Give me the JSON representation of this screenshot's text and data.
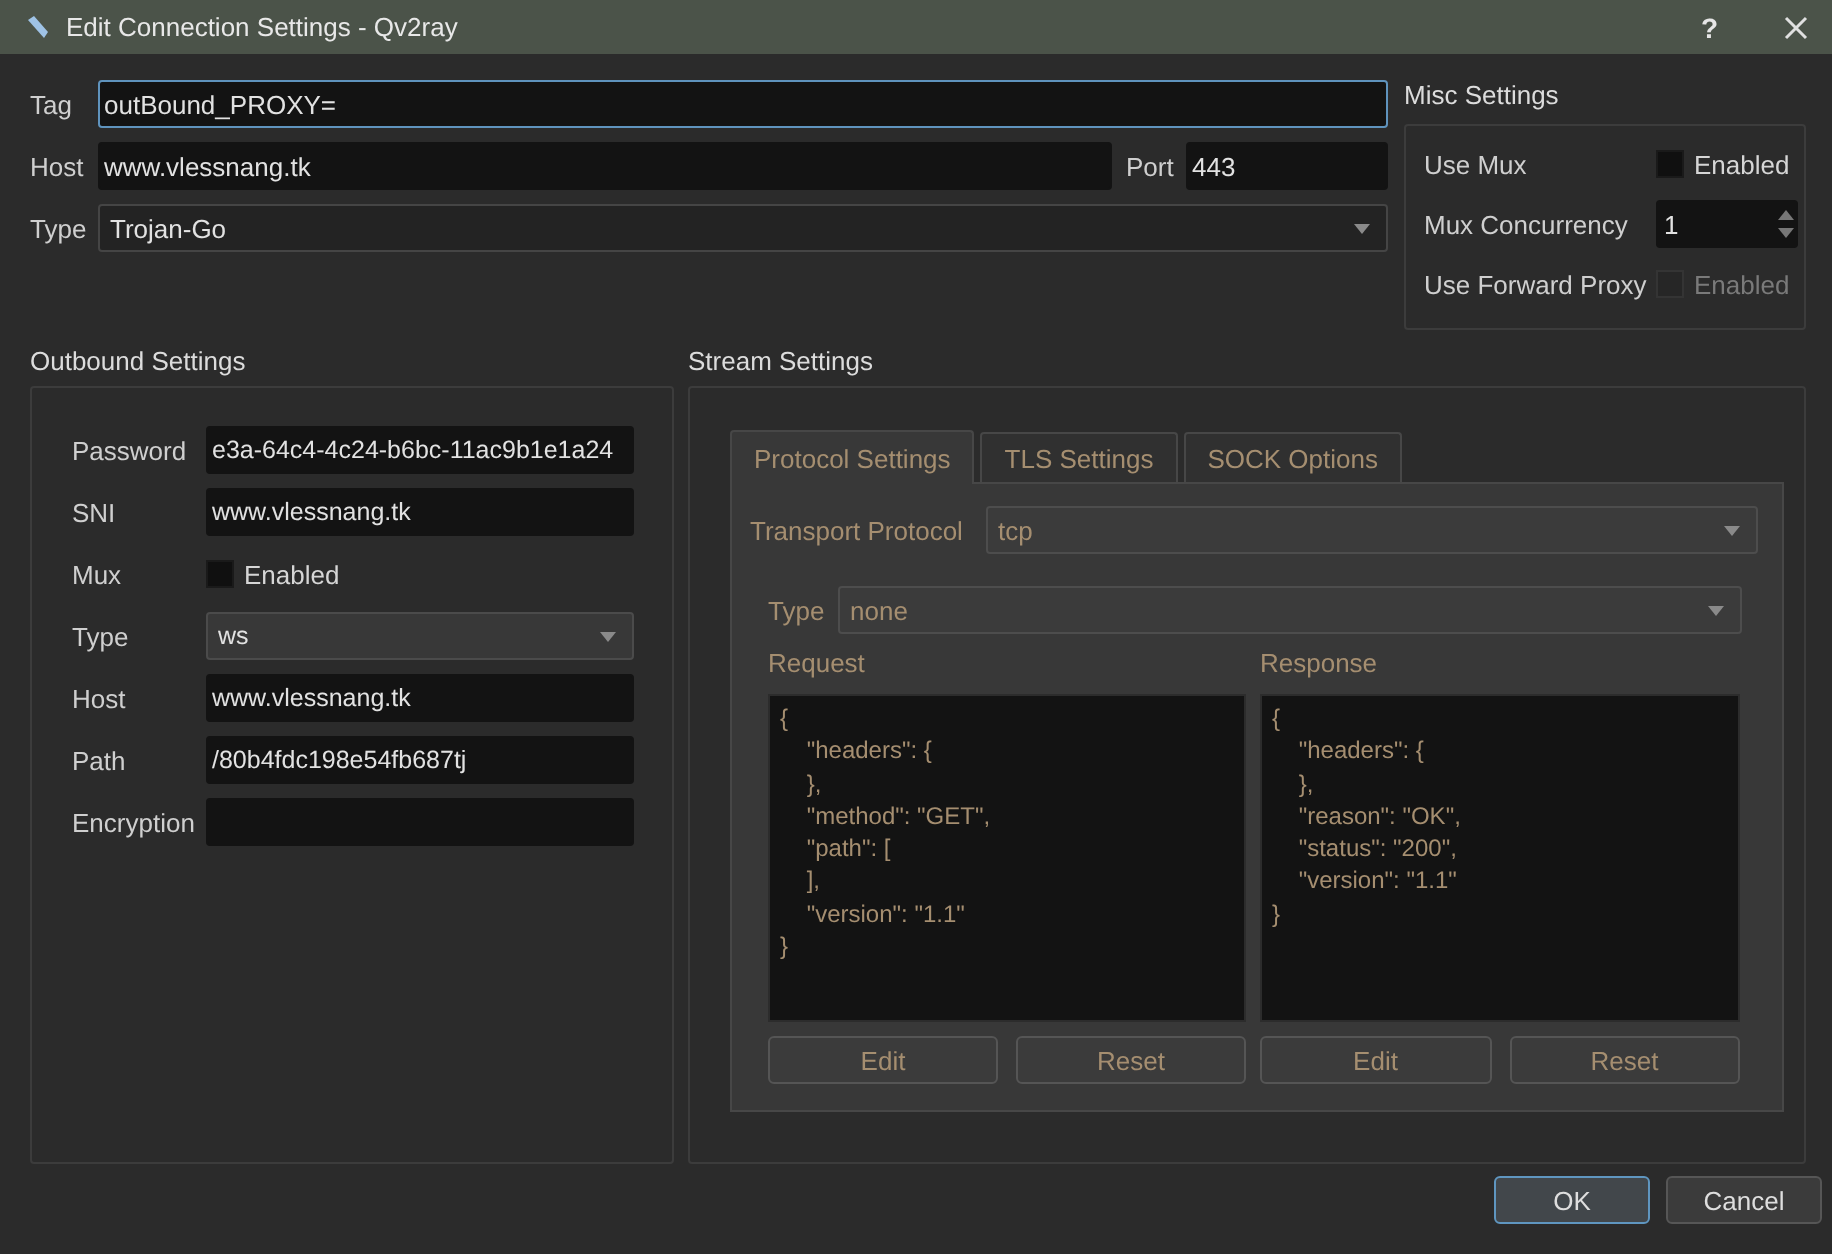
{
  "window": {
    "title": "Edit Connection Settings - Qv2ray",
    "help": "?"
  },
  "general": {
    "tag": {
      "label": "Tag",
      "value": "outBound_PROXY=",
      "focused": true
    },
    "host": {
      "label": "Host",
      "value": "www.vlessnang.tk",
      "focused": false
    },
    "port": {
      "label": "Port",
      "value": "443",
      "focused": false
    },
    "type": {
      "label": "Type",
      "value": "Trojan-Go"
    }
  },
  "misc_settings": {
    "title": "Misc Settings",
    "rows": [
      {
        "kind": "checkbox",
        "label": "Use Mux",
        "text": "Enabled",
        "checked": false,
        "disabled": false
      },
      {
        "kind": "spinbox",
        "label": "Mux Concurrency",
        "value": "1"
      },
      {
        "kind": "checkbox",
        "label": "Use Forward Proxy",
        "text": "Enabled",
        "checked": false,
        "disabled": true
      }
    ]
  },
  "outbound_settings": {
    "title": "Outbound Settings",
    "rows": [
      {
        "kind": "field",
        "label": "Password",
        "value": "e3a-64c4-4c24-b6bc-11ac9b1e1a24"
      },
      {
        "kind": "field",
        "label": "SNI",
        "value": "www.vlessnang.tk"
      },
      {
        "kind": "checkbox",
        "label": "Mux",
        "text": "Enabled",
        "checked": false
      },
      {
        "kind": "combo",
        "label": "Type",
        "value": "ws"
      },
      {
        "kind": "field",
        "label": "Host",
        "value": "www.vlessnang.tk"
      },
      {
        "kind": "field",
        "label": "Path",
        "value": "/80b4fdc198e54fb687tj"
      },
      {
        "kind": "field",
        "label": "Encryption"
      }
    ]
  },
  "stream_settings": {
    "title": "Stream Settings",
    "disabled": true,
    "tabs": [
      {
        "label": "Protocol Settings",
        "selected": true
      },
      {
        "label": "TLS Settings",
        "selected": false
      },
      {
        "label": "SOCK Options",
        "selected": false
      }
    ],
    "transport": {
      "label": "Transport Protocol",
      "value": "tcp"
    },
    "type": {
      "label": "Type",
      "value": "none"
    },
    "editors": [
      {
        "label": "Request",
        "text": "{\n    \"headers\": {\n    },\n    \"method\": \"GET\",\n    \"path\": [\n    ],\n    \"version\": \"1.1\"\n}",
        "buttons": [
          "Edit",
          "Reset"
        ]
      },
      {
        "label": "Response",
        "text": "{\n    \"headers\": {\n    },\n    \"reason\": \"OK\",\n    \"status\": \"200\",\n    \"version\": \"1.1\"\n}",
        "buttons": [
          "Edit",
          "Reset"
        ]
      }
    ]
  },
  "dialog_buttons": [
    {
      "label": "OK",
      "default": true
    },
    {
      "label": "Cancel",
      "default": false
    }
  ]
}
